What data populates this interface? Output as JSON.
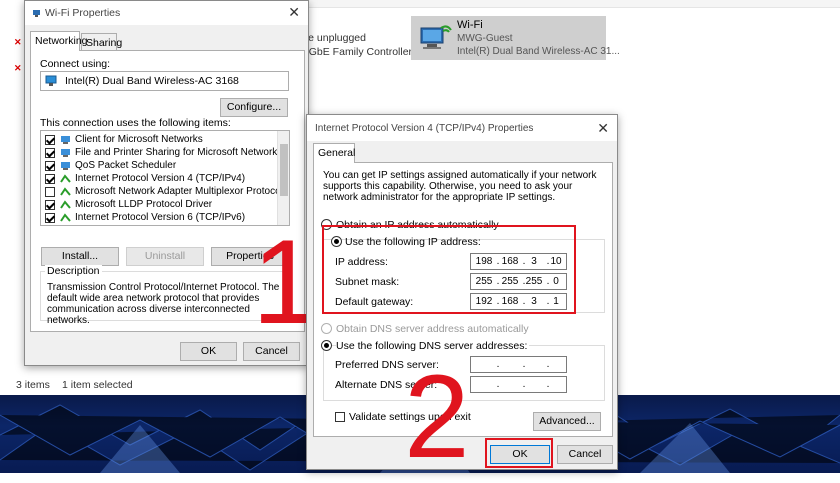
{
  "background": {
    "connections": [
      {
        "line1": "ble unplugged",
        "line2": "e GbE Family Controller"
      }
    ],
    "wifi_tile": {
      "name": "Wi-Fi",
      "network": "MWG-Guest",
      "adapter": "Intel(R) Dual Band Wireless-AC 31..."
    },
    "status": {
      "items": "3 items",
      "selected": "1 item selected"
    }
  },
  "wifi_properties": {
    "title": "Wi-Fi Properties",
    "tabs": [
      "Networking",
      "Sharing"
    ],
    "connect_using_label": "Connect using:",
    "adapter_name": "Intel(R) Dual Band Wireless-AC 3168",
    "configure_button": "Configure...",
    "items_label": "This connection uses the following items:",
    "items": [
      {
        "label": "Client for Microsoft Networks",
        "checked": true
      },
      {
        "label": "File and Printer Sharing for Microsoft Networks",
        "checked": true
      },
      {
        "label": "QoS Packet Scheduler",
        "checked": true
      },
      {
        "label": "Internet Protocol Version 4 (TCP/IPv4)",
        "checked": true
      },
      {
        "label": "Microsoft Network Adapter Multiplexor Protocol",
        "checked": false
      },
      {
        "label": "Microsoft LLDP Protocol Driver",
        "checked": true
      },
      {
        "label": "Internet Protocol Version 6 (TCP/IPv6)",
        "checked": true
      }
    ],
    "install_button": "Install...",
    "uninstall_button": "Uninstall",
    "properties_button": "Properties",
    "description_label": "Description",
    "description_text": "Transmission Control Protocol/Internet Protocol. The default wide area network protocol that provides communication across diverse interconnected networks.",
    "ok_button": "OK",
    "cancel_button": "Cancel"
  },
  "ipv4_properties": {
    "title": "Internet Protocol Version 4 (TCP/IPv4) Properties",
    "tab": "General",
    "intro": "You can get IP settings assigned automatically if your network supports this capability. Otherwise, you need to ask your network administrator for the appropriate IP settings.",
    "obtain_ip_auto": "Obtain an IP address automatically",
    "use_following_ip": "Use the following IP address:",
    "ip_address_label": "IP address:",
    "ip_address": [
      "198",
      "168",
      "3",
      "10"
    ],
    "subnet_mask_label": "Subnet mask:",
    "subnet_mask": [
      "255",
      "255",
      "255",
      "0"
    ],
    "default_gateway_label": "Default gateway:",
    "default_gateway": [
      "192",
      "168",
      "3",
      "1"
    ],
    "obtain_dns_auto": "Obtain DNS server address automatically",
    "use_following_dns": "Use the following DNS server addresses:",
    "preferred_dns_label": "Preferred DNS server:",
    "alternate_dns_label": "Alternate DNS server:",
    "validate_label": "Validate settings upon exit",
    "advanced_button": "Advanced...",
    "ok_button": "OK",
    "cancel_button": "Cancel"
  },
  "annotations": {
    "step1": "1",
    "step2": "2",
    "highlight_color": "#e0141e"
  }
}
